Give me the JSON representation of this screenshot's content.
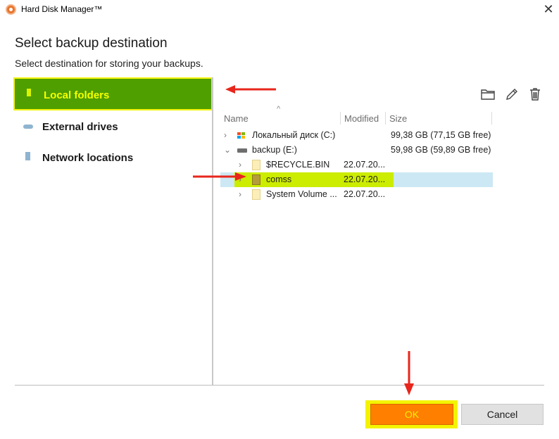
{
  "window": {
    "title": "Hard Disk Manager™",
    "close_glyph": "✕"
  },
  "page": {
    "heading": "Select backup destination",
    "subheading": "Select destination for storing your backups."
  },
  "sidebar": {
    "items": [
      {
        "label": "Local folders",
        "icon": "folder-icon",
        "active": true
      },
      {
        "label": "External drives",
        "icon": "drive-icon",
        "active": false
      },
      {
        "label": "Network locations",
        "icon": "network-icon",
        "active": false
      }
    ]
  },
  "toolbar": {
    "icons": [
      "new-folder-icon",
      "rename-icon",
      "delete-icon"
    ]
  },
  "table": {
    "columns": {
      "name": "Name",
      "modified": "Modified",
      "size": "Size"
    },
    "sort_glyph": "^",
    "rows": [
      {
        "expander": "›",
        "name": "Локальный диск (C:)",
        "modified": "",
        "size": "99,38 GB (77,15 GB free)",
        "icon": "windows-drive-icon"
      },
      {
        "expander": "⌄",
        "name": "backup (E:)",
        "modified": "",
        "size": "59,98 GB (59,89 GB free)",
        "icon": "external-drive-icon"
      },
      {
        "expander": "›",
        "name": "$RECYCLE.BIN",
        "modified": "22.07.20...",
        "size": "",
        "icon": "folder-icon"
      },
      {
        "expander": "›",
        "name": "comss",
        "modified": "22.07.20...",
        "size": "",
        "icon": "folder-icon",
        "selected": true
      },
      {
        "expander": "›",
        "name": "System Volume ...",
        "modified": "22.07.20...",
        "size": "",
        "icon": "folder-icon"
      }
    ]
  },
  "buttons": {
    "ok": "OK",
    "cancel": "Cancel"
  },
  "colors": {
    "active_nav_bg": "#4f9f00",
    "highlight_yellow": "#f2f200",
    "ok_orange": "#ff7f00",
    "selection_blue": "#cce8f4",
    "annotation_red": "#e8261c"
  }
}
